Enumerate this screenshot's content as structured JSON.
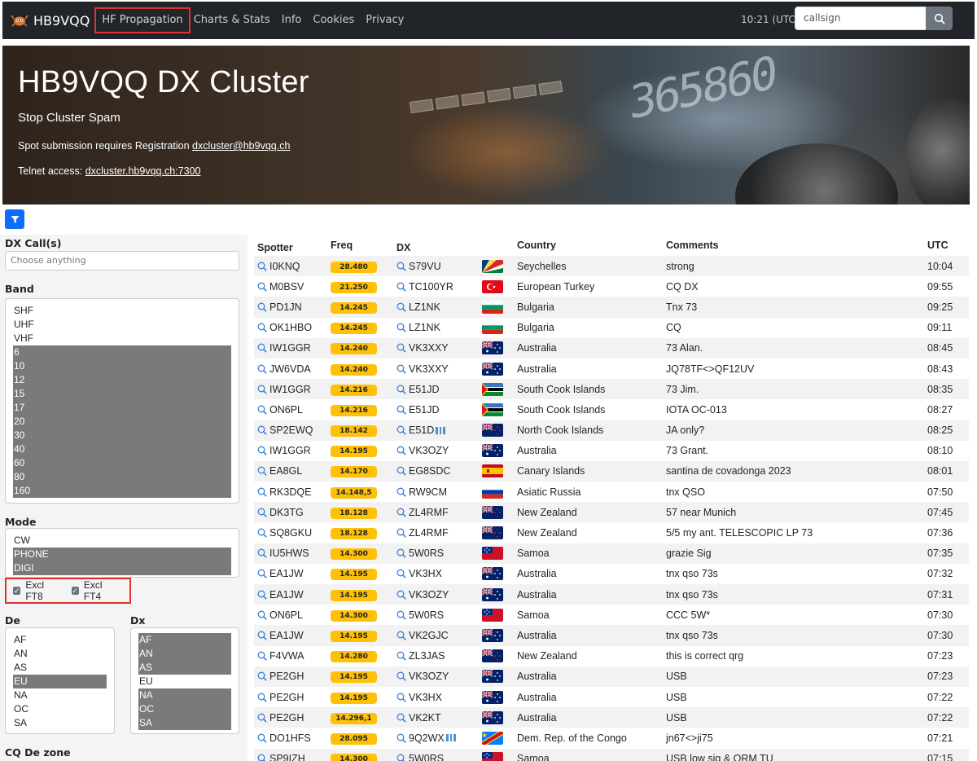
{
  "navbar": {
    "brand": "HB9VQQ",
    "links": [
      "HF Propagation",
      "Charts & Stats",
      "Info",
      "Cookies",
      "Privacy"
    ],
    "time": "10:21 (UTC)",
    "search_placeholder": "callsign"
  },
  "hero": {
    "title": "HB9VQQ DX Cluster",
    "lead": "Stop Cluster Spam",
    "registration_text": "Spot submission requires Registration",
    "registration_link": "dxcluster@hb9vqq.ch",
    "telnet_text": "Telnet access:",
    "telnet_link": "dxcluster.hb9vqq.ch:7300",
    "display_digits": "365860"
  },
  "filters": {
    "dx_calls_label": "DX Call(s)",
    "dx_calls_placeholder": "Choose anything",
    "band_label": "Band",
    "bands": [
      {
        "label": "SHF",
        "selected": false
      },
      {
        "label": "UHF",
        "selected": false
      },
      {
        "label": "VHF",
        "selected": false
      },
      {
        "label": "6",
        "selected": true
      },
      {
        "label": "10",
        "selected": true
      },
      {
        "label": "12",
        "selected": true
      },
      {
        "label": "15",
        "selected": true
      },
      {
        "label": "17",
        "selected": true
      },
      {
        "label": "20",
        "selected": true
      },
      {
        "label": "30",
        "selected": true
      },
      {
        "label": "40",
        "selected": true
      },
      {
        "label": "60",
        "selected": true
      },
      {
        "label": "80",
        "selected": true
      },
      {
        "label": "160",
        "selected": true
      }
    ],
    "mode_label": "Mode",
    "modes": [
      {
        "label": "CW",
        "selected": false
      },
      {
        "label": "PHONE",
        "selected": true
      },
      {
        "label": "DIGI",
        "selected": true
      }
    ],
    "excl_ft8": "Excl FT8",
    "excl_ft4": "Excl FT4",
    "de_label": "De",
    "de": [
      {
        "label": "AF",
        "selected": false
      },
      {
        "label": "AN",
        "selected": false
      },
      {
        "label": "AS",
        "selected": false
      },
      {
        "label": "EU",
        "selected": true
      },
      {
        "label": "NA",
        "selected": false
      },
      {
        "label": "OC",
        "selected": false
      },
      {
        "label": "SA",
        "selected": false
      }
    ],
    "dx_label": "Dx",
    "dx": [
      {
        "label": "AF",
        "selected": true
      },
      {
        "label": "AN",
        "selected": true
      },
      {
        "label": "AS",
        "selected": true
      },
      {
        "label": "EU",
        "selected": false
      },
      {
        "label": "NA",
        "selected": true
      },
      {
        "label": "OC",
        "selected": true
      },
      {
        "label": "SA",
        "selected": true
      }
    ],
    "cq_de_zone_label": "CQ De zone"
  },
  "table": {
    "headers": {
      "spotter": "Spotter",
      "freq": "Freq",
      "dx": "DX",
      "country": "Country",
      "comments": "Comments",
      "utc": "UTC"
    },
    "rows": [
      {
        "spotter": "I0KNQ",
        "freq": "28.480",
        "dx": "S79VU",
        "flag": "seychelles",
        "country": "Seychelles",
        "comments": "strong",
        "utc": "10:04",
        "note": false
      },
      {
        "spotter": "M0BSV",
        "freq": "21.250",
        "dx": "TC100YR",
        "flag": "turkey",
        "country": "European Turkey",
        "comments": "CQ DX",
        "utc": "09:55",
        "note": false
      },
      {
        "spotter": "PD1JN",
        "freq": "14.245",
        "dx": "LZ1NK",
        "flag": "bulgaria",
        "country": "Bulgaria",
        "comments": "Tnx 73",
        "utc": "09:25",
        "note": false
      },
      {
        "spotter": "OK1HBO",
        "freq": "14.245",
        "dx": "LZ1NK",
        "flag": "bulgaria",
        "country": "Bulgaria",
        "comments": "CQ",
        "utc": "09:11",
        "note": false
      },
      {
        "spotter": "IW1GGR",
        "freq": "14.240",
        "dx": "VK3XXY",
        "flag": "australia",
        "country": "Australia",
        "comments": "73 Alan.",
        "utc": "08:45",
        "note": false
      },
      {
        "spotter": "JW6VDA",
        "freq": "14.240",
        "dx": "VK3XXY",
        "flag": "australia",
        "country": "Australia",
        "comments": "JQ78TF<>QF12UV",
        "utc": "08:43",
        "note": false
      },
      {
        "spotter": "IW1GGR",
        "freq": "14.216",
        "dx": "E51JD",
        "flag": "cook",
        "country": "South Cook Islands",
        "comments": "73 Jim.",
        "utc": "08:35",
        "note": false
      },
      {
        "spotter": "ON6PL",
        "freq": "14.216",
        "dx": "E51JD",
        "flag": "cook",
        "country": "South Cook Islands",
        "comments": "IOTA OC-013",
        "utc": "08:27",
        "note": false
      },
      {
        "spotter": "SP2EWQ",
        "freq": "18.142",
        "dx": "E51D",
        "flag": "newzealand",
        "country": "North Cook Islands",
        "comments": "JA only?",
        "utc": "08:25",
        "note": true
      },
      {
        "spotter": "IW1GGR",
        "freq": "14.195",
        "dx": "VK3OZY",
        "flag": "australia",
        "country": "Australia",
        "comments": "73 Grant.",
        "utc": "08:10",
        "note": false
      },
      {
        "spotter": "EA8GL",
        "freq": "14.170",
        "dx": "EG8SDC",
        "flag": "spain",
        "country": "Canary Islands",
        "comments": "santina de covadonga 2023",
        "utc": "08:01",
        "note": false
      },
      {
        "spotter": "RK3DQE",
        "freq": "14.148,5",
        "dx": "RW9CM",
        "flag": "russia",
        "country": "Asiatic Russia",
        "comments": "tnx QSO",
        "utc": "07:50",
        "note": false
      },
      {
        "spotter": "DK3TG",
        "freq": "18.128",
        "dx": "ZL4RMF",
        "flag": "newzealand",
        "country": "New Zealand",
        "comments": "57 near Munich",
        "utc": "07:45",
        "note": false
      },
      {
        "spotter": "SQ8GKU",
        "freq": "18.128",
        "dx": "ZL4RMF",
        "flag": "newzealand",
        "country": "New Zealand",
        "comments": "5/5 my ant. TELESCOPIC LP 73",
        "utc": "07:36",
        "note": false
      },
      {
        "spotter": "IU5HWS",
        "freq": "14.300",
        "dx": "5W0RS",
        "flag": "samoa",
        "country": "Samoa",
        "comments": "grazie Sig",
        "utc": "07:35",
        "note": false
      },
      {
        "spotter": "EA1JW",
        "freq": "14.195",
        "dx": "VK3HX",
        "flag": "australia",
        "country": "Australia",
        "comments": "tnx qso 73s",
        "utc": "07:32",
        "note": false
      },
      {
        "spotter": "EA1JW",
        "freq": "14.195",
        "dx": "VK3OZY",
        "flag": "australia",
        "country": "Australia",
        "comments": "tnx qso 73s",
        "utc": "07:31",
        "note": false
      },
      {
        "spotter": "ON6PL",
        "freq": "14.300",
        "dx": "5W0RS",
        "flag": "samoa",
        "country": "Samoa",
        "comments": "CCC 5W*",
        "utc": "07:30",
        "note": false
      },
      {
        "spotter": "EA1JW",
        "freq": "14.195",
        "dx": "VK2GJC",
        "flag": "australia",
        "country": "Australia",
        "comments": "tnx qso 73s",
        "utc": "07:30",
        "note": false
      },
      {
        "spotter": "F4VWA",
        "freq": "14.280",
        "dx": "ZL3JAS",
        "flag": "newzealand",
        "country": "New Zealand",
        "comments": "this is correct qrg",
        "utc": "07:23",
        "note": false
      },
      {
        "spotter": "PE2GH",
        "freq": "14.195",
        "dx": "VK3OZY",
        "flag": "australia",
        "country": "Australia",
        "comments": "USB",
        "utc": "07:23",
        "note": false
      },
      {
        "spotter": "PE2GH",
        "freq": "14.195",
        "dx": "VK3HX",
        "flag": "australia",
        "country": "Australia",
        "comments": "USB",
        "utc": "07:22",
        "note": false
      },
      {
        "spotter": "PE2GH",
        "freq": "14.296,1",
        "dx": "VK2KT",
        "flag": "australia",
        "country": "Australia",
        "comments": "USB",
        "utc": "07:22",
        "note": false
      },
      {
        "spotter": "DO1HFS",
        "freq": "28.095",
        "dx": "9Q2WX",
        "flag": "congo",
        "country": "Dem. Rep. of the Congo",
        "comments": "jn67<>ji75",
        "utc": "07:21",
        "note": true
      },
      {
        "spotter": "SP9IZH",
        "freq": "14.300",
        "dx": "5W0RS",
        "flag": "samoa",
        "country": "Samoa",
        "comments": "USB low sig & QRM TU",
        "utc": "07:15",
        "note": false
      }
    ]
  },
  "colors": {
    "navbar": "#212529",
    "accent": "#0d6efd",
    "freq_badge": "#ffc107",
    "selected_option": "#7a7a7a",
    "highlight_box": "#e03030"
  }
}
